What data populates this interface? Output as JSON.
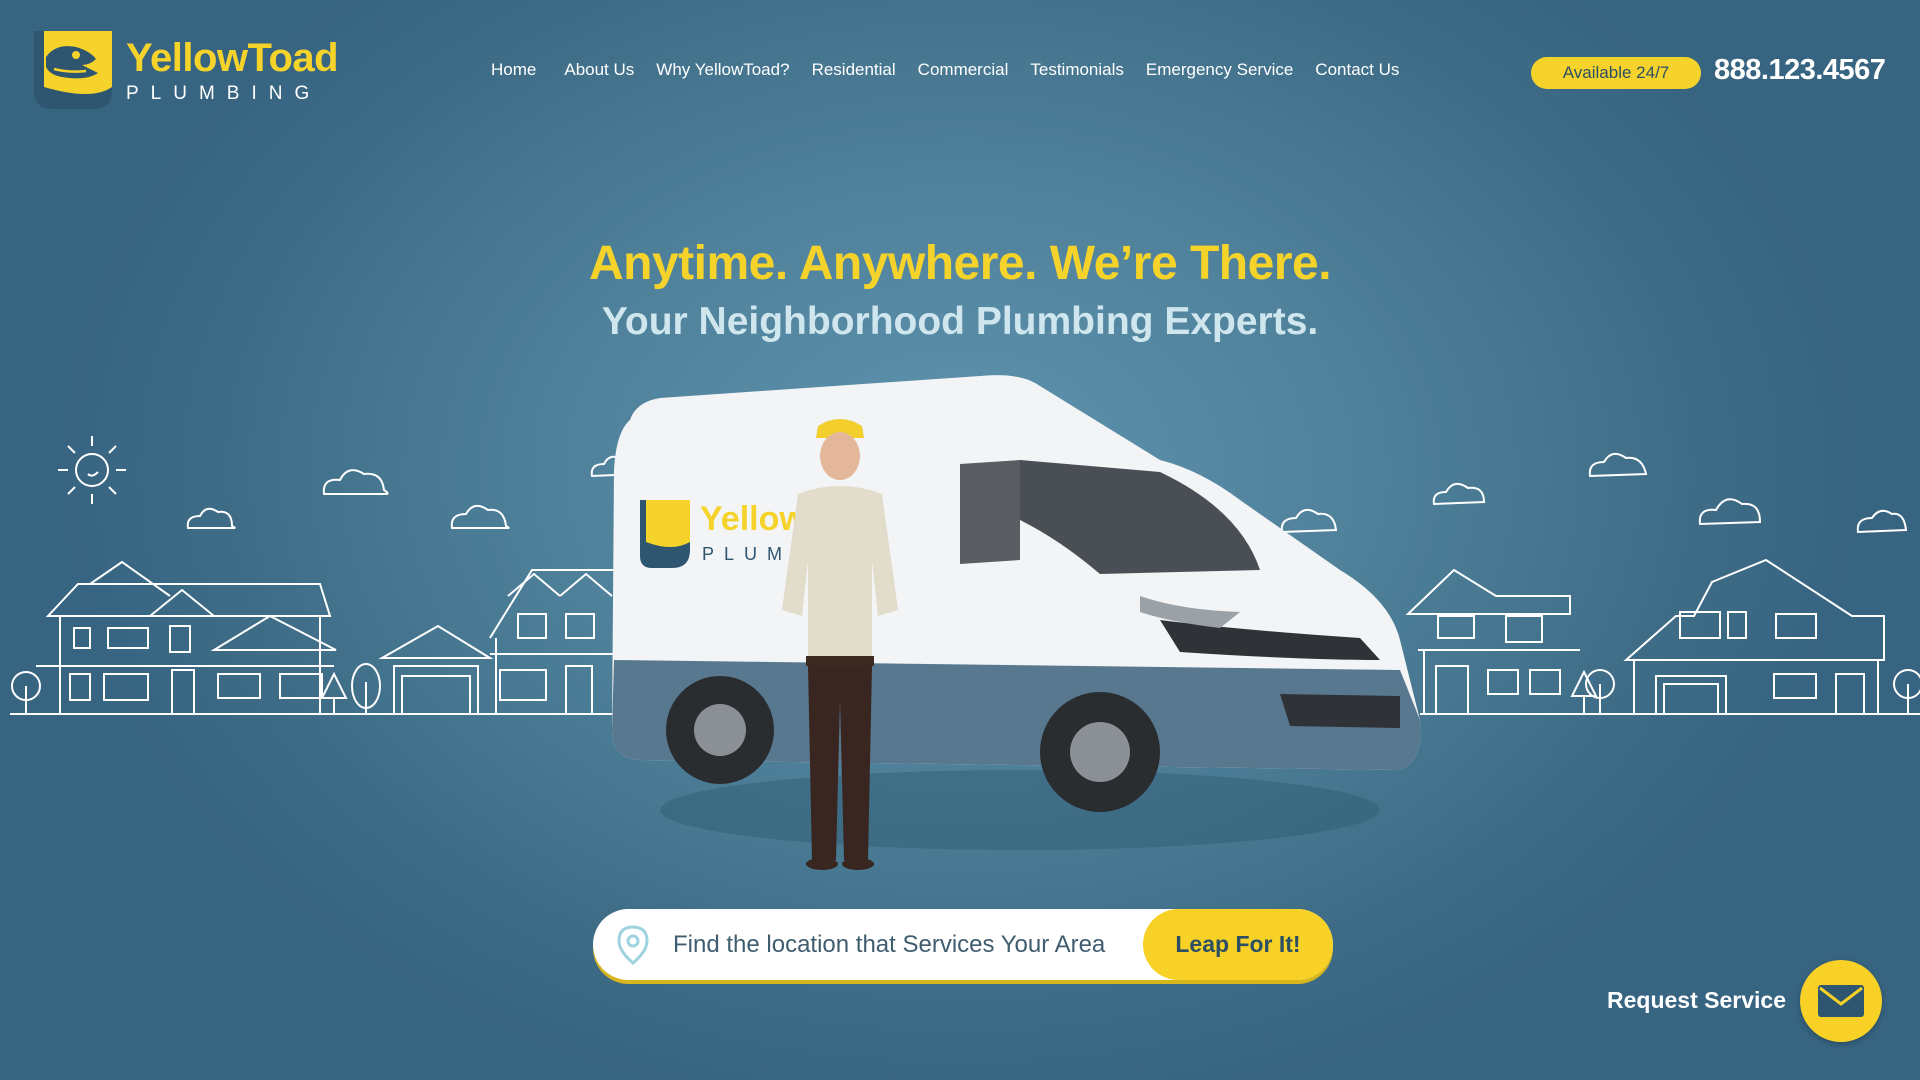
{
  "brand": {
    "name": "YellowToad",
    "tagline": "PLUMBING",
    "accent": "#f5d32a",
    "dark": "#2d4f64"
  },
  "nav": {
    "items": [
      {
        "label": "Home"
      },
      {
        "label": "About Us"
      },
      {
        "label": "Why YellowToad?"
      },
      {
        "label": "Residential"
      },
      {
        "label": "Commercial"
      },
      {
        "label": "Testimonials"
      },
      {
        "label": "Emergency Service"
      },
      {
        "label": "Contact Us"
      }
    ]
  },
  "header": {
    "availability": "Available 24/7",
    "phone": "888.123.4567"
  },
  "hero": {
    "headline": "Anytime. Anywhere. We’re There.",
    "subheadline": "Your Neighborhood Plumbing Experts."
  },
  "van": {
    "brand_name": "YellowToad",
    "brand_sub": "PLUMBING"
  },
  "search": {
    "placeholder": "Find the location that Services Your Area",
    "button": "Leap For It!",
    "icon": "location-pin-icon"
  },
  "request": {
    "label": "Request Service",
    "icon": "envelope-icon"
  }
}
